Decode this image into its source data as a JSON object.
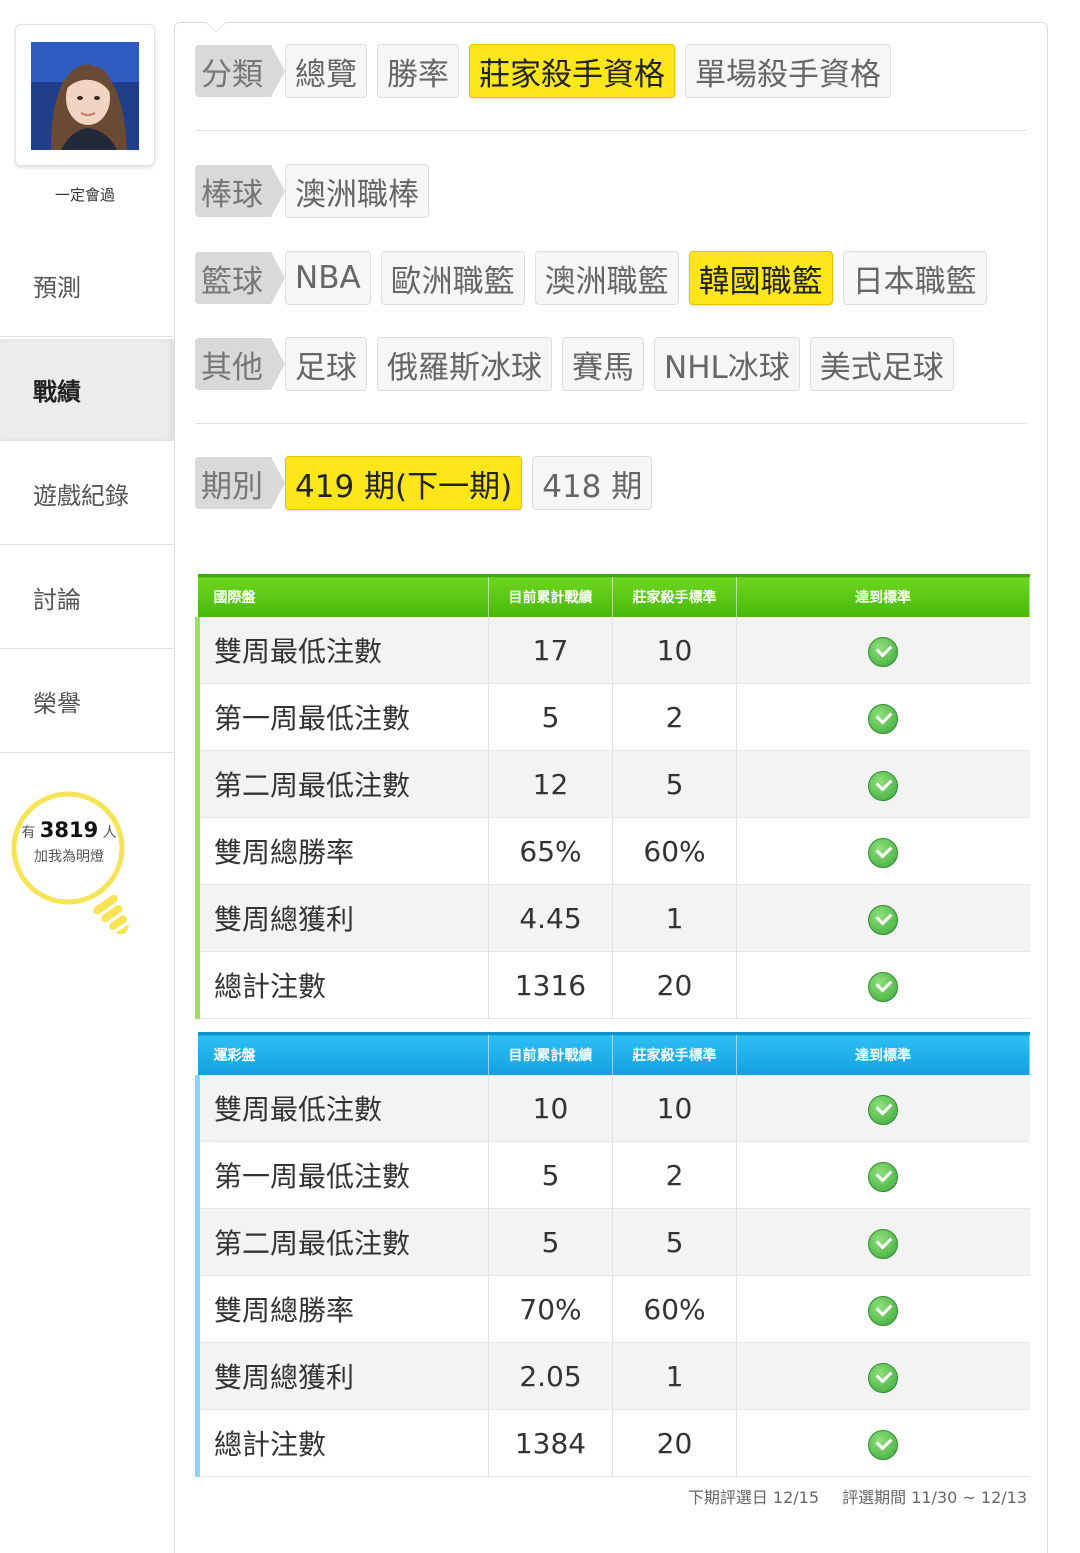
{
  "sidebar": {
    "username": "一定會過",
    "nav": [
      "預測",
      "戰績",
      "遊戲紀錄",
      "討論",
      "榮譽"
    ],
    "active_index": 1,
    "fans": {
      "prefix": "有",
      "count": "3819",
      "suffix": "人",
      "caption": "加我為明燈"
    }
  },
  "filters": {
    "category": {
      "tag": "分類",
      "options": [
        "總覽",
        "勝率",
        "莊家殺手資格",
        "單場殺手資格"
      ],
      "active": "莊家殺手資格"
    },
    "baseball": {
      "tag": "棒球",
      "options": [
        "澳洲職棒"
      ]
    },
    "basketball": {
      "tag": "籃球",
      "options": [
        "NBA",
        "歐洲職籃",
        "澳洲職籃",
        "韓國職籃",
        "日本職籃"
      ],
      "active": "韓國職籃"
    },
    "other": {
      "tag": "其他",
      "options": [
        "足球",
        "俄羅斯冰球",
        "賽馬",
        "NHL冰球",
        "美式足球"
      ]
    },
    "period": {
      "tag": "期別",
      "options": [
        "419 期(下一期)",
        "418 期"
      ],
      "active": "419 期(下一期)"
    }
  },
  "tables": [
    {
      "title": "國際盤",
      "headers": [
        "目前累計戰績",
        "莊家殺手標準",
        "達到標準"
      ],
      "rows": [
        {
          "label": "雙周最低注數",
          "current": "17",
          "standard": "10"
        },
        {
          "label": "第一周最低注數",
          "current": "5",
          "standard": "2"
        },
        {
          "label": "第二周最低注數",
          "current": "12",
          "standard": "5"
        },
        {
          "label": "雙周總勝率",
          "current": "65%",
          "standard": "60%"
        },
        {
          "label": "雙周總獲利",
          "current": "4.45",
          "standard": "1"
        },
        {
          "label": "總計注數",
          "current": "1316",
          "standard": "20"
        }
      ]
    },
    {
      "title": "運彩盤",
      "headers": [
        "目前累計戰績",
        "莊家殺手標準",
        "達到標準"
      ],
      "rows": [
        {
          "label": "雙周最低注數",
          "current": "10",
          "standard": "10"
        },
        {
          "label": "第一周最低注數",
          "current": "5",
          "standard": "2"
        },
        {
          "label": "第二周最低注數",
          "current": "5",
          "standard": "5"
        },
        {
          "label": "雙周總勝率",
          "current": "70%",
          "standard": "60%"
        },
        {
          "label": "雙周總獲利",
          "current": "2.05",
          "standard": "1"
        },
        {
          "label": "總計注數",
          "current": "1384",
          "standard": "20"
        }
      ]
    }
  ],
  "footer": {
    "next_date": "下期評選日 12/15",
    "period": "評選期間 11/30 ~ 12/13"
  }
}
